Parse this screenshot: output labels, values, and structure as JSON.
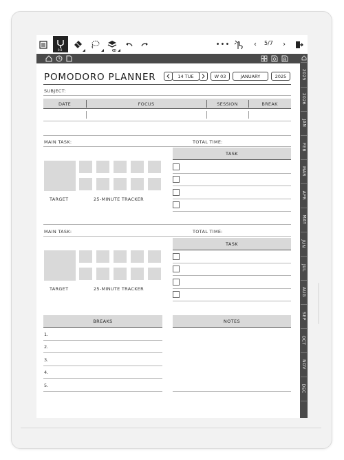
{
  "toolbar": {
    "page_indicator": "5/7"
  },
  "planner": {
    "title": "POMODORO PLANNER",
    "day": "14 TUE",
    "week": "W 03",
    "month": "JANUARY",
    "year": "2025",
    "subject_label": "SUBJECT:",
    "session_headers": [
      "DATE",
      "FOCUS",
      "SESSION",
      "BREAK"
    ],
    "main_task_label": "MAIN TASK:",
    "total_time_label": "TOTAL TIME:",
    "task_header": "TASK",
    "target_label": "TARGET",
    "tracker_label": "25-MINUTE TRACKER",
    "breaks_header": "BREAKS",
    "notes_header": "NOTES",
    "break_items": [
      "1.",
      "2.",
      "3.",
      "4.",
      "5."
    ]
  },
  "side_tabs": [
    "2025",
    "2026",
    "JAN",
    "FEB",
    "MAR",
    "APR",
    "MAY",
    "JUN",
    "JUL",
    "AUG",
    "SEP",
    "OCT",
    "NOV",
    "DEC"
  ],
  "colors": {
    "tab_bar": "#4a4a4a",
    "header_fill": "#d9d9d9",
    "tracker_fill": "#d9d9d9"
  }
}
